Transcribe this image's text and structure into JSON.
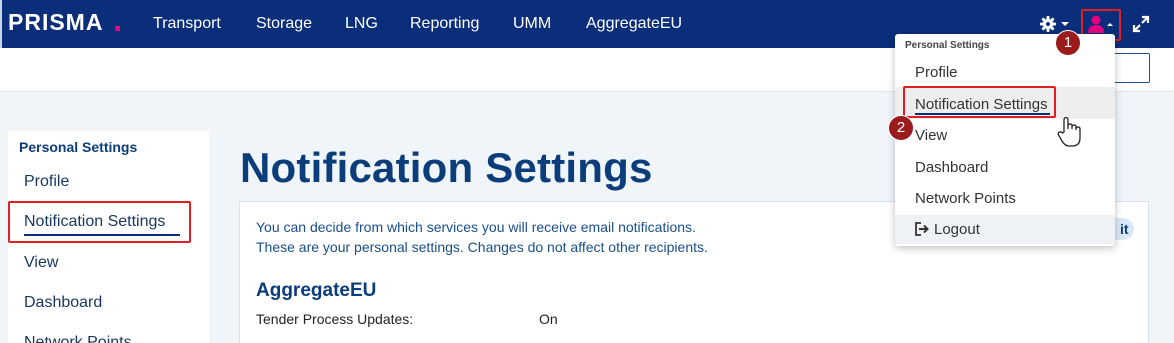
{
  "brand": {
    "name": "PRISMA",
    "accent": "#e6007e",
    "navbar_color": "#0a2e7a"
  },
  "nav": {
    "items": [
      "Transport",
      "Storage",
      "LNG",
      "Reporting",
      "UMM",
      "AggregateEU"
    ]
  },
  "icons": {
    "settings": "gear-icon",
    "user": "user-icon",
    "expand": "expand-icon",
    "logout": "logout-icon"
  },
  "sidebar": {
    "heading": "Personal Settings",
    "items": [
      "Profile",
      "Notification Settings",
      "View",
      "Dashboard",
      "Network Points"
    ]
  },
  "main": {
    "title": "Notification Settings",
    "info_line1": "You can decide from which services you will receive email notifications.",
    "info_line2": "These are your personal settings. Changes do not affect other recipients.",
    "pill_text": "it",
    "section": "AggregateEU",
    "row_label": "Tender Process Updates:",
    "row_value": "On"
  },
  "dropdown": {
    "heading": "Personal Settings",
    "items": [
      "Profile",
      "Notification Settings",
      "View",
      "Dashboard",
      "Network Points",
      "Logout"
    ]
  },
  "markers": [
    "1",
    "2"
  ]
}
